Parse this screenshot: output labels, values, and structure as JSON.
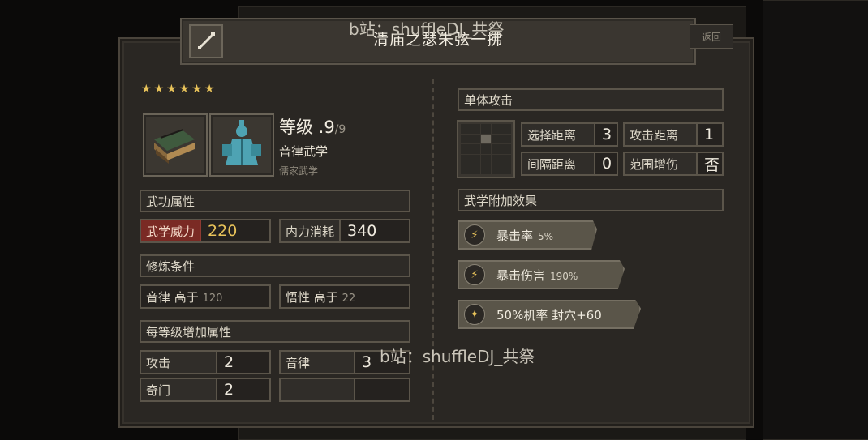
{
  "watermark": "b站：shuffleDJ_共祭",
  "title": "清庙之瑟朱弦一拂",
  "back_label": "返回",
  "stars": [
    "★",
    "★",
    "★",
    "★",
    "★",
    "★"
  ],
  "skill": {
    "level_label": "等级 .9",
    "level_max": "/9",
    "category": "音律武学",
    "school": "儒家武学"
  },
  "sections": {
    "attributes": "武功属性",
    "requirements": "修炼条件",
    "per_level": "每等级增加属性",
    "single_attack": "单体攻击",
    "extra_effects": "武学附加效果"
  },
  "attributes": {
    "power_label": "武学威力",
    "power_value": "220",
    "cost_label": "内力消耗",
    "cost_value": "340"
  },
  "requirements": [
    {
      "label": "音律 高于",
      "value": "120"
    },
    {
      "label": "悟性 高于",
      "value": "22"
    }
  ],
  "per_level": [
    {
      "label": "攻击",
      "value": "2"
    },
    {
      "label": "音律",
      "value": "3"
    },
    {
      "label": "奇门",
      "value": "2"
    },
    {
      "label": "",
      "value": ""
    }
  ],
  "range": {
    "select_label": "选择距离",
    "select_value": "3",
    "attack_label": "攻击距离",
    "attack_value": "1",
    "interval_label": "间隔距离",
    "interval_value": "0",
    "aoe_label": "范围增伤",
    "aoe_value": "否"
  },
  "effects": [
    {
      "text": "暴击率",
      "value": "5%",
      "icon": "lightning-icon"
    },
    {
      "text": "暴击伤害",
      "value": "190%",
      "icon": "lightning-icon"
    },
    {
      "text": "50%机率 封穴+60",
      "value": "",
      "icon": "acupoint-icon"
    }
  ],
  "colors": {
    "accent_gold": "#e8c35a",
    "power_red": "#7a2a24",
    "panel": "#2a2723"
  }
}
